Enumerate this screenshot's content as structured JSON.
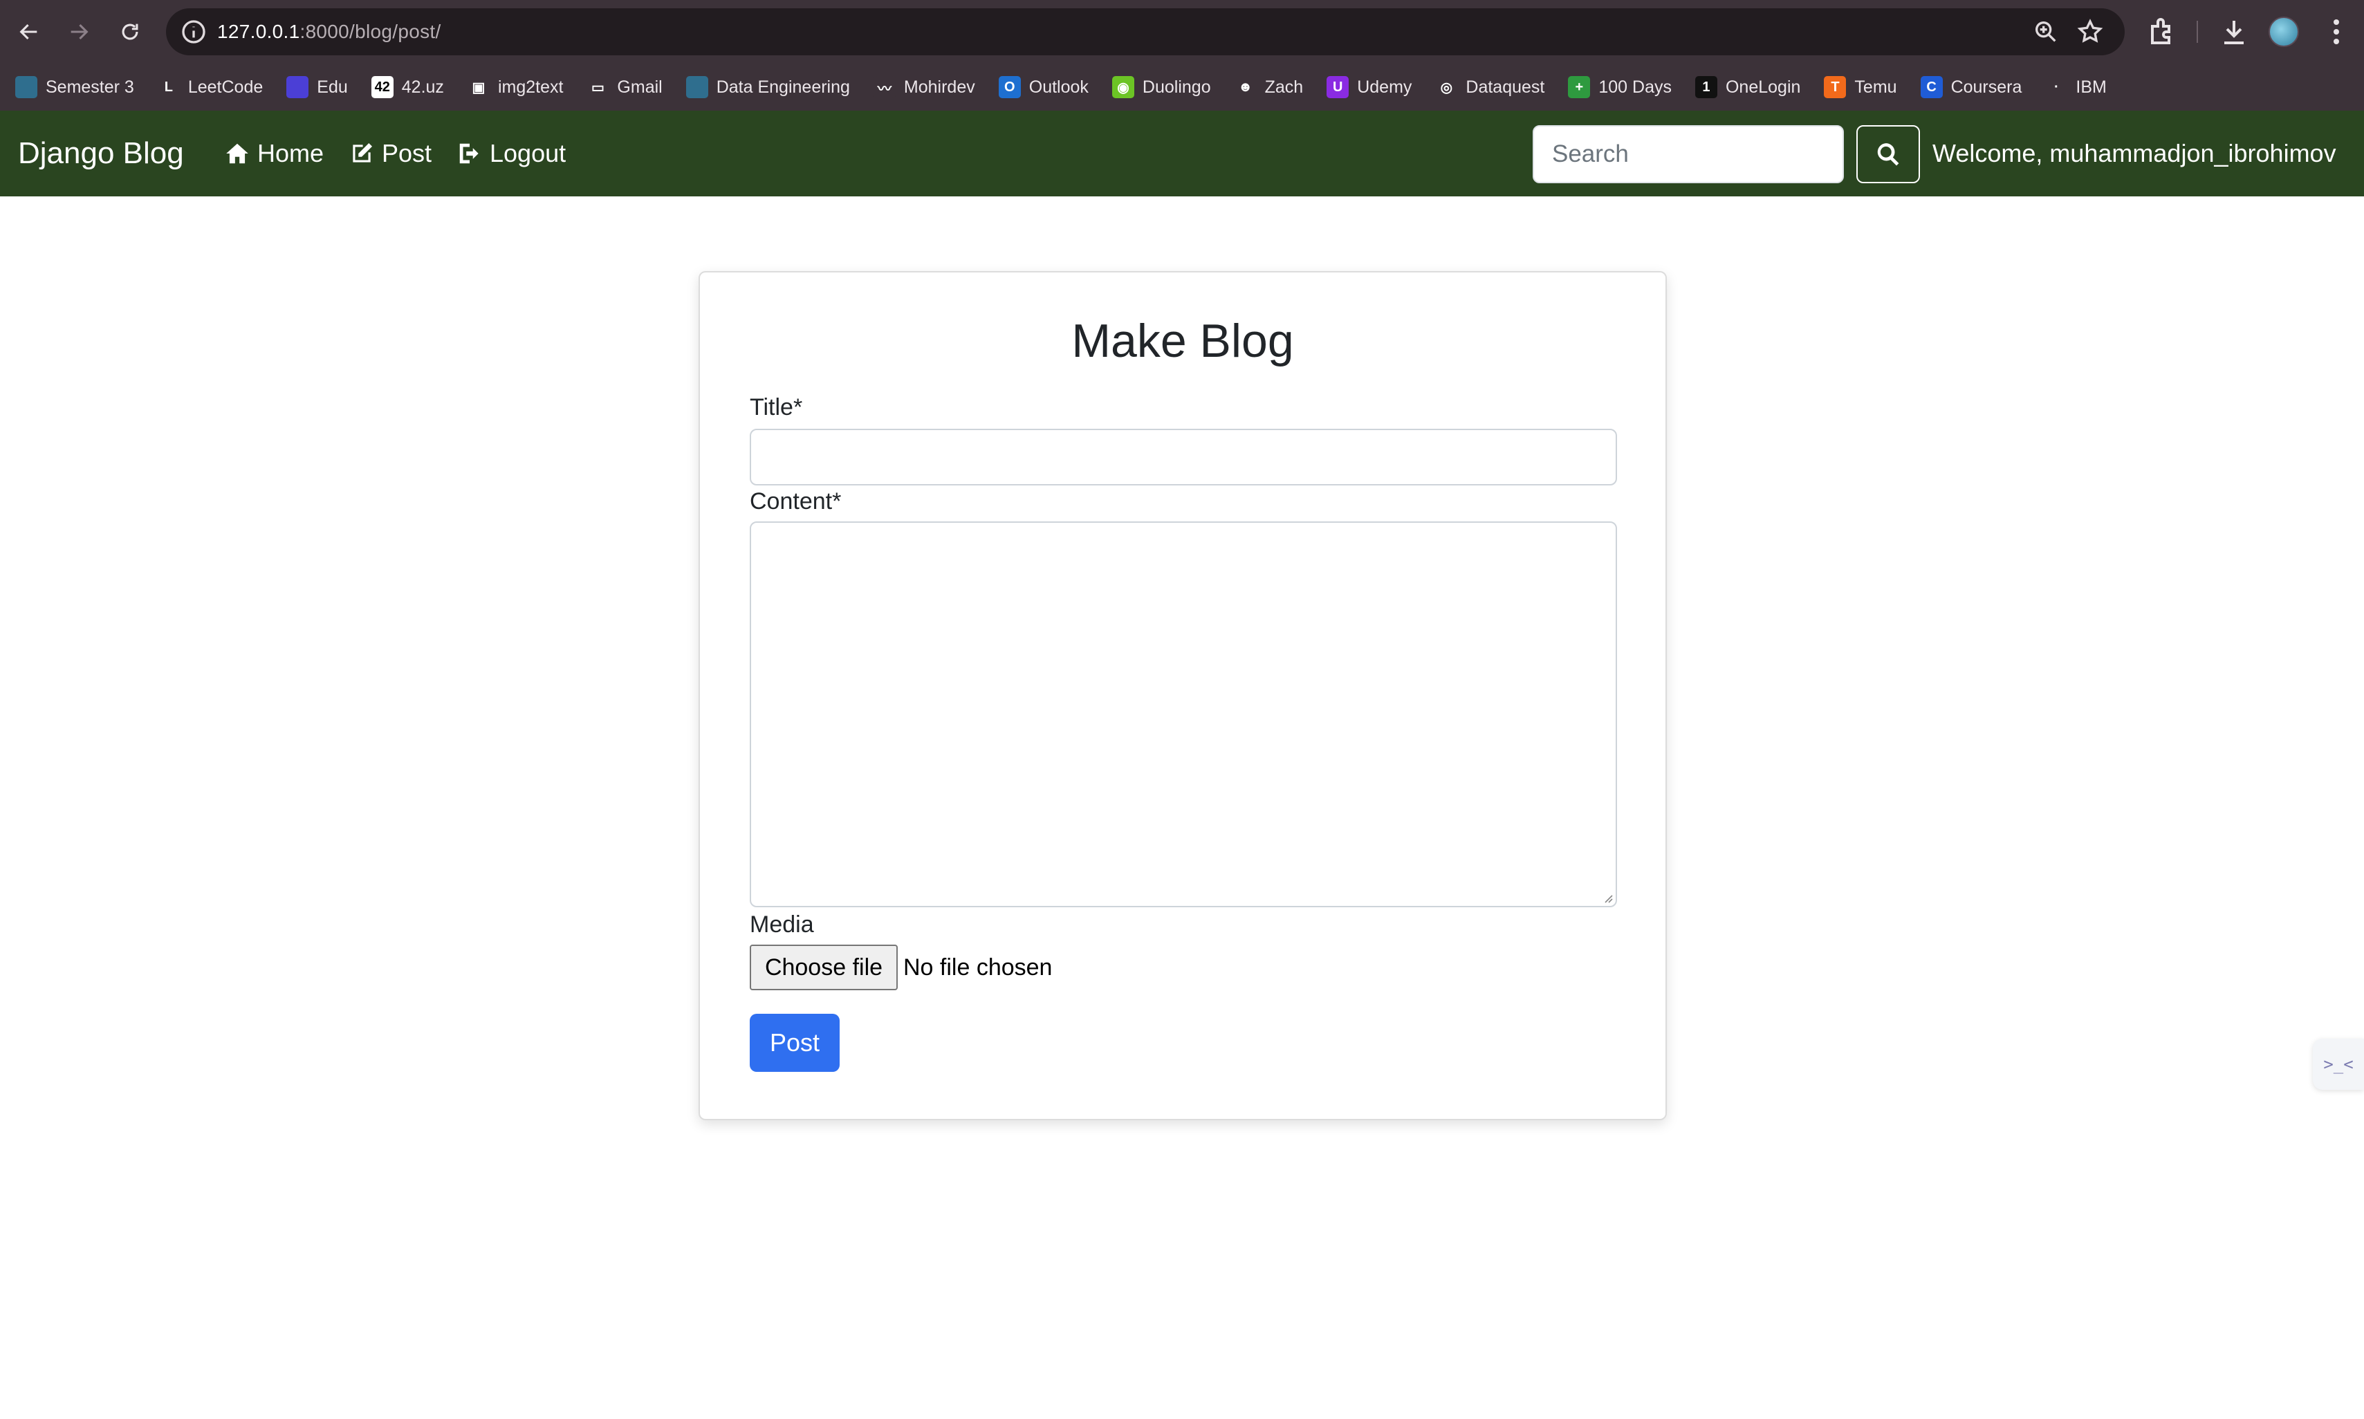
{
  "browser": {
    "url_host": "127.0.0.1",
    "url_rest": ":8000/blog/post/",
    "icons": [
      "back-icon",
      "forward-icon",
      "reload-icon",
      "site-info-icon",
      "zoom-icon",
      "bookmark-star-icon",
      "extensions-icon",
      "download-icon",
      "profile-avatar",
      "kebab-menu-icon"
    ]
  },
  "bookmarks": [
    {
      "label": "Semester 3",
      "color": "#2f6e8e",
      "glyph": ""
    },
    {
      "label": "LeetCode",
      "color": "#3c3239",
      "glyph": "L"
    },
    {
      "label": "Edu",
      "color": "#4b3fd6",
      "glyph": ""
    },
    {
      "label": "42.uz",
      "color": "#ffffff",
      "glyph": "42"
    },
    {
      "label": "img2text",
      "color": "#3c3239",
      "glyph": "▣"
    },
    {
      "label": "Gmail",
      "color": "#3c3239",
      "glyph": "▭"
    },
    {
      "label": "Data Engineering",
      "color": "#2f6e8e",
      "glyph": ""
    },
    {
      "label": "Mohirdev",
      "color": "#3c3239",
      "glyph": "〰"
    },
    {
      "label": "Outlook",
      "color": "#1e6fd0",
      "glyph": "O"
    },
    {
      "label": "Duolingo",
      "color": "#6cc425",
      "glyph": "◉"
    },
    {
      "label": "Zach",
      "color": "#3c3239",
      "glyph": "☻"
    },
    {
      "label": "Udemy",
      "color": "#8a2be2",
      "glyph": "U"
    },
    {
      "label": "Dataquest",
      "color": "#3c3239",
      "glyph": "◎"
    },
    {
      "label": "100 Days",
      "color": "#2e9a3f",
      "glyph": "+"
    },
    {
      "label": "OneLogin",
      "color": "#111111",
      "glyph": "1"
    },
    {
      "label": "Temu",
      "color": "#f26a1b",
      "glyph": "T"
    },
    {
      "label": "Coursera",
      "color": "#1f5cd6",
      "glyph": "C"
    },
    {
      "label": "IBM",
      "color": "#3c3239",
      "glyph": "·"
    }
  ],
  "navbar": {
    "brand": "Django Blog",
    "home": "Home",
    "post": "Post",
    "logout": "Logout",
    "search_placeholder": "Search",
    "welcome": "Welcome, muhammadjon_ibrohimov",
    "bg_color": "#2a4520"
  },
  "form": {
    "heading": "Make Blog",
    "title_label": "Title*",
    "title_value": "",
    "content_label": "Content*",
    "content_value": "",
    "media_label": "Media",
    "choose_file": "Choose file",
    "file_status": "No file chosen",
    "submit": "Post",
    "submit_color": "#2f6ff0"
  },
  "side_tab": {
    "glyph": ">_<"
  }
}
